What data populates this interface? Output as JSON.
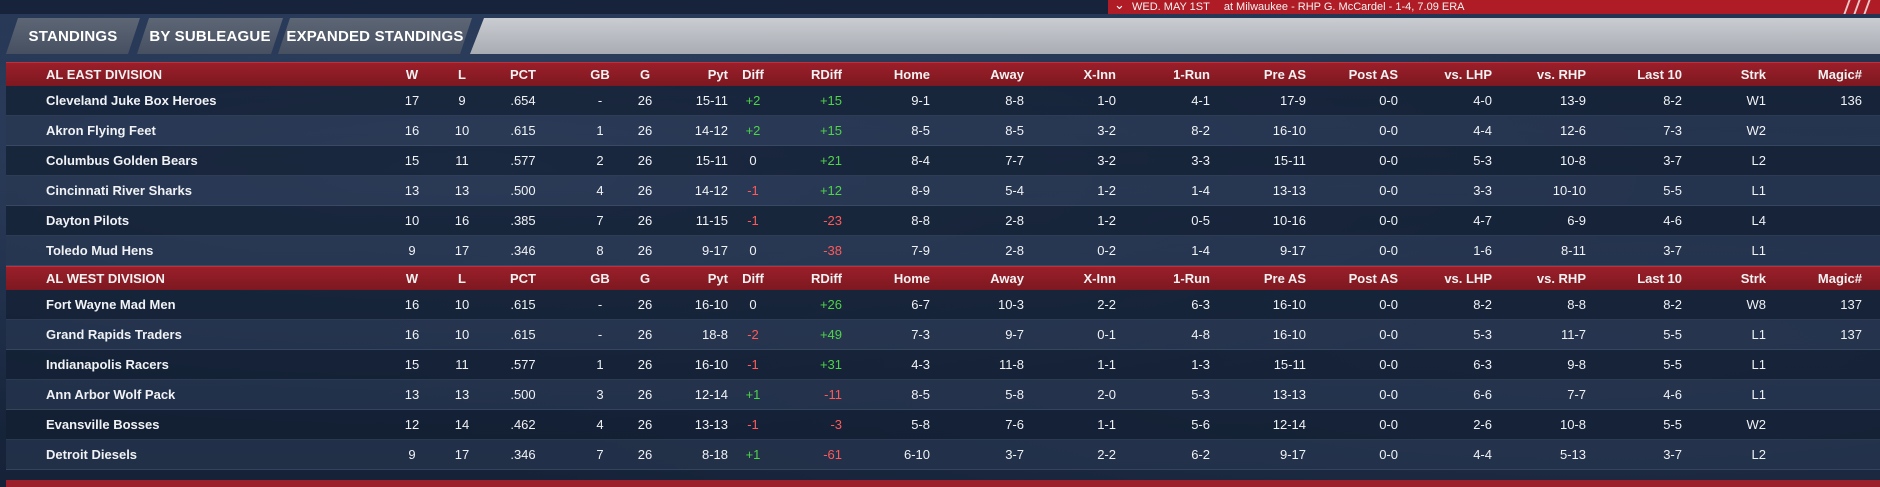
{
  "banner": {
    "date": "WED. MAY 1ST",
    "matchup": "at Milwaukee - RHP G. McCardel - 1-4, 7.09 ERA"
  },
  "tabs": [
    {
      "label": "STANDINGS"
    },
    {
      "label": "BY SUBLEAGUE"
    },
    {
      "label": "EXPANDED STANDINGS"
    }
  ],
  "columns": {
    "w": "W",
    "l": "L",
    "pct": "PCT",
    "gb": "GB",
    "g": "G",
    "pyt": "Pyt",
    "diff": "Diff",
    "rdiff": "RDiff",
    "home": "Home",
    "away": "Away",
    "xinn": "X-Inn",
    "run1": "1-Run",
    "preas": "Pre AS",
    "postas": "Post AS",
    "vlhp": "vs. LHP",
    "vrhp": "vs. RHP",
    "last10": "Last 10",
    "strk": "Strk",
    "magic": "Magic#"
  },
  "divisions": [
    {
      "name": "AL EAST DIVISION",
      "teams": [
        {
          "name": "Cleveland Juke Box Heroes",
          "w": "17",
          "l": "9",
          "pct": ".654",
          "gb": "-",
          "g": "26",
          "pyt": "15-11",
          "diff": "+2",
          "rdiff": "+15",
          "home": "9-1",
          "away": "8-8",
          "xinn": "1-0",
          "run1": "4-1",
          "preas": "17-9",
          "postas": "0-0",
          "vlhp": "4-0",
          "vrhp": "13-9",
          "last10": "8-2",
          "strk": "W1",
          "magic": "136"
        },
        {
          "name": "Akron  Flying Feet",
          "w": "16",
          "l": "10",
          "pct": ".615",
          "gb": "1",
          "g": "26",
          "pyt": "14-12",
          "diff": "+2",
          "rdiff": "+15",
          "home": "8-5",
          "away": "8-5",
          "xinn": "3-2",
          "run1": "8-2",
          "preas": "16-10",
          "postas": "0-0",
          "vlhp": "4-4",
          "vrhp": "12-6",
          "last10": "7-3",
          "strk": "W2",
          "magic": ""
        },
        {
          "name": "Columbus Golden Bears",
          "w": "15",
          "l": "11",
          "pct": ".577",
          "gb": "2",
          "g": "26",
          "pyt": "15-11",
          "diff": "0",
          "rdiff": "+21",
          "home": "8-4",
          "away": "7-7",
          "xinn": "3-2",
          "run1": "3-3",
          "preas": "15-11",
          "postas": "0-0",
          "vlhp": "5-3",
          "vrhp": "10-8",
          "last10": "3-7",
          "strk": "L2",
          "magic": ""
        },
        {
          "name": "Cincinnati River Sharks",
          "w": "13",
          "l": "13",
          "pct": ".500",
          "gb": "4",
          "g": "26",
          "pyt": "14-12",
          "diff": "-1",
          "rdiff": "+12",
          "home": "8-9",
          "away": "5-4",
          "xinn": "1-2",
          "run1": "1-4",
          "preas": "13-13",
          "postas": "0-0",
          "vlhp": "3-3",
          "vrhp": "10-10",
          "last10": "5-5",
          "strk": "L1",
          "magic": ""
        },
        {
          "name": "Dayton Pilots",
          "w": "10",
          "l": "16",
          "pct": ".385",
          "gb": "7",
          "g": "26",
          "pyt": "11-15",
          "diff": "-1",
          "rdiff": "-23",
          "home": "8-8",
          "away": "2-8",
          "xinn": "1-2",
          "run1": "0-5",
          "preas": "10-16",
          "postas": "0-0",
          "vlhp": "4-7",
          "vrhp": "6-9",
          "last10": "4-6",
          "strk": "L4",
          "magic": ""
        },
        {
          "name": "Toledo  Mud Hens",
          "w": "9",
          "l": "17",
          "pct": ".346",
          "gb": "8",
          "g": "26",
          "pyt": "9-17",
          "diff": "0",
          "rdiff": "-38",
          "home": "7-9",
          "away": "2-8",
          "xinn": "0-2",
          "run1": "1-4",
          "preas": "9-17",
          "postas": "0-0",
          "vlhp": "1-6",
          "vrhp": "8-11",
          "last10": "3-7",
          "strk": "L1",
          "magic": ""
        }
      ]
    },
    {
      "name": "AL WEST DIVISION",
      "teams": [
        {
          "name": "Fort Wayne Mad Men",
          "w": "16",
          "l": "10",
          "pct": ".615",
          "gb": "-",
          "g": "26",
          "pyt": "16-10",
          "diff": "0",
          "rdiff": "+26",
          "home": "6-7",
          "away": "10-3",
          "xinn": "2-2",
          "run1": "6-3",
          "preas": "16-10",
          "postas": "0-0",
          "vlhp": "8-2",
          "vrhp": "8-8",
          "last10": "8-2",
          "strk": "W8",
          "magic": "137"
        },
        {
          "name": "Grand Rapids Traders",
          "w": "16",
          "l": "10",
          "pct": ".615",
          "gb": "-",
          "g": "26",
          "pyt": "18-8",
          "diff": "-2",
          "rdiff": "+49",
          "home": "7-3",
          "away": "9-7",
          "xinn": "0-1",
          "run1": "4-8",
          "preas": "16-10",
          "postas": "0-0",
          "vlhp": "5-3",
          "vrhp": "11-7",
          "last10": "5-5",
          "strk": "L1",
          "magic": "137"
        },
        {
          "name": "Indianapolis Racers",
          "w": "15",
          "l": "11",
          "pct": ".577",
          "gb": "1",
          "g": "26",
          "pyt": "16-10",
          "diff": "-1",
          "rdiff": "+31",
          "home": "4-3",
          "away": "11-8",
          "xinn": "1-1",
          "run1": "1-3",
          "preas": "15-11",
          "postas": "0-0",
          "vlhp": "6-3",
          "vrhp": "9-8",
          "last10": "5-5",
          "strk": "L1",
          "magic": ""
        },
        {
          "name": "Ann Arbor Wolf Pack",
          "w": "13",
          "l": "13",
          "pct": ".500",
          "gb": "3",
          "g": "26",
          "pyt": "12-14",
          "diff": "+1",
          "rdiff": "-11",
          "home": "8-5",
          "away": "5-8",
          "xinn": "2-0",
          "run1": "5-3",
          "preas": "13-13",
          "postas": "0-0",
          "vlhp": "6-6",
          "vrhp": "7-7",
          "last10": "4-6",
          "strk": "L1",
          "magic": ""
        },
        {
          "name": "Evansville Bosses",
          "w": "12",
          "l": "14",
          "pct": ".462",
          "gb": "4",
          "g": "26",
          "pyt": "13-13",
          "diff": "-1",
          "rdiff": "-3",
          "home": "5-8",
          "away": "7-6",
          "xinn": "1-1",
          "run1": "5-6",
          "preas": "12-14",
          "postas": "0-0",
          "vlhp": "2-6",
          "vrhp": "10-8",
          "last10": "5-5",
          "strk": "W2",
          "magic": ""
        },
        {
          "name": "Detroit Diesels",
          "w": "9",
          "l": "17",
          "pct": ".346",
          "gb": "7",
          "g": "26",
          "pyt": "8-18",
          "diff": "+1",
          "rdiff": "-61",
          "home": "6-10",
          "away": "3-7",
          "xinn": "2-2",
          "run1": "6-2",
          "preas": "9-17",
          "postas": "0-0",
          "vlhp": "4-4",
          "vrhp": "5-13",
          "last10": "3-7",
          "strk": "L2",
          "magic": ""
        }
      ]
    }
  ],
  "colors": {
    "positive": "#4fd34a",
    "negative": "#ff5a5a",
    "division_header": "#9a1f2a",
    "banner": "#b01c25"
  }
}
